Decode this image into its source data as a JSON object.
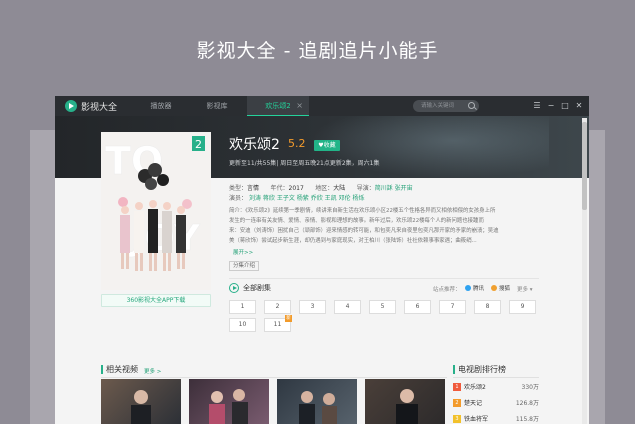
{
  "headline": "影视大全 - 追剧追片小能手",
  "titlebar": {
    "app_title": "影视大全",
    "tabs": [
      {
        "label": "播放器"
      },
      {
        "label": "影视库"
      },
      {
        "label": "欢乐颂2",
        "close": "×"
      }
    ],
    "search_placeholder": "请输入关键词",
    "menu_glyph": "☰",
    "min_glyph": "−",
    "max_glyph": "□",
    "close_glyph": "✕"
  },
  "show": {
    "title": "欢乐颂2",
    "rating": "5.2",
    "fav_label": "♥收藏",
    "update_text": "更新至11/共55集| 周日至周五晚21点更新2集，周六1集",
    "poster_text_top": "TO",
    "poster_text_bottom": "JOY",
    "poster_badge": "2",
    "app_download": "360影视大全APP下载"
  },
  "info": {
    "genre_label": "类型：",
    "genre": "言情",
    "year_label": "年代：",
    "year": "2017",
    "region_label": "地区：",
    "region": "大陆",
    "director_label": "导演：",
    "director": "简川訸  张开宙",
    "cast_label": "演员：",
    "cast": [
      "刘涛",
      "蒋欣",
      "王子文",
      "杨紫",
      "乔欣",
      "王凯",
      "邓伦",
      "杨烁"
    ],
    "intro_lines": [
      "简介：《欢乐颂2》延续第一季剧情，续讲来自新生活在欢乐颂小区22楼五个性格各异而又相依相偎的女孩身上所",
      "发生的一连串有关友情、爱情、亲情、影视和理想的故事。新年过后，欢乐颂22楼每个人的新问题也接踵而",
      "来：安迪（刘涛饰）困扰自己（顽部饰）迎来情感的转可能，和包奕凡来自夜里包奕凡那开家的矛家的崩溃；吴迪",
      "美（蒋欣饰）尝试起步新生涯，却仍遇到与家庭现实，对王柏川（张陆饰）社社依赖事事家遇；曲筱绡..."
    ],
    "expand": "展开>>",
    "tag": "分集介绍"
  },
  "episodes": {
    "title": "全部剧集",
    "source_label": "站点推荐：",
    "sources": [
      "腾讯",
      "搜狐"
    ],
    "more": "更多 ▾",
    "items": [
      "1",
      "2",
      "3",
      "4",
      "5",
      "6",
      "7",
      "8",
      "9",
      "10",
      "11"
    ],
    "new_badge": "新"
  },
  "related": {
    "title": "相关视频",
    "more": "更多 >"
  },
  "ranking": {
    "title": "电视剧排行榜",
    "items": [
      {
        "num": "1",
        "name": "欢乐颂2",
        "value": "330万",
        "color": "#f05a3c"
      },
      {
        "num": "2",
        "name": "楚天记",
        "value": "126.8万",
        "color": "#f39b2b"
      },
      {
        "num": "3",
        "name": "铁血将军",
        "value": "115.8万",
        "color": "#f2c12b"
      }
    ]
  },
  "colors": {
    "accent": "#27b08a",
    "titlebar": "#2a2d31",
    "rating": "#f39b2c"
  }
}
